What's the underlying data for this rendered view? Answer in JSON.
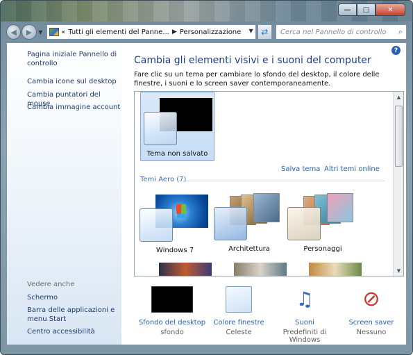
{
  "window": {
    "min_symbol": "—",
    "max_symbol": "□",
    "close_symbol": "✕"
  },
  "nav": {
    "back_icon": "back-arrow-icon",
    "forward_icon": "forward-arrow-icon",
    "breadcrumb_prefix": "«",
    "breadcrumbs": [
      "Tutti gli elementi del Panne...",
      "Personalizzazione"
    ],
    "search_placeholder": "Cerca nel Pannello di controllo"
  },
  "sidebar": {
    "home_link": "Pagina iniziale Pannello di controllo",
    "links": [
      "Cambia icone sul desktop",
      "Cambia puntatori del mouse",
      "Cambia immagine account"
    ],
    "see_also_heading": "Vedere anche",
    "see_also": [
      "Schermo",
      "Barra delle applicazioni e menu Start",
      "Centro accessibilità"
    ]
  },
  "main": {
    "help_label": "?",
    "title": "Cambia gli elementi visivi e i suoni del computer",
    "description": "Fare clic su un tema per cambiare lo sfondo del desktop, il colore delle finestre, i suoni e lo screen saver contemporaneamente.",
    "unsaved_theme": "Tema non salvato",
    "save_theme": "Salva tema",
    "more_themes": "Altri temi online",
    "aero_group": "Temi Aero (7)",
    "themes": [
      "Windows 7",
      "Architettura",
      "Personaggi"
    ]
  },
  "bottom": {
    "items": [
      {
        "name": "Sfondo del desktop",
        "value": "sfondo"
      },
      {
        "name": "Colore finestre",
        "value": "Celeste"
      },
      {
        "name": "Suoni",
        "value": "Predefiniti di Windows"
      },
      {
        "name": "Screen saver",
        "value": "Nessuno"
      }
    ]
  },
  "colors": {
    "link": "#2563b5",
    "title": "#1d3f8a",
    "sidebar_link": "#1c3a6e",
    "group_header": "#3f6fb4"
  }
}
